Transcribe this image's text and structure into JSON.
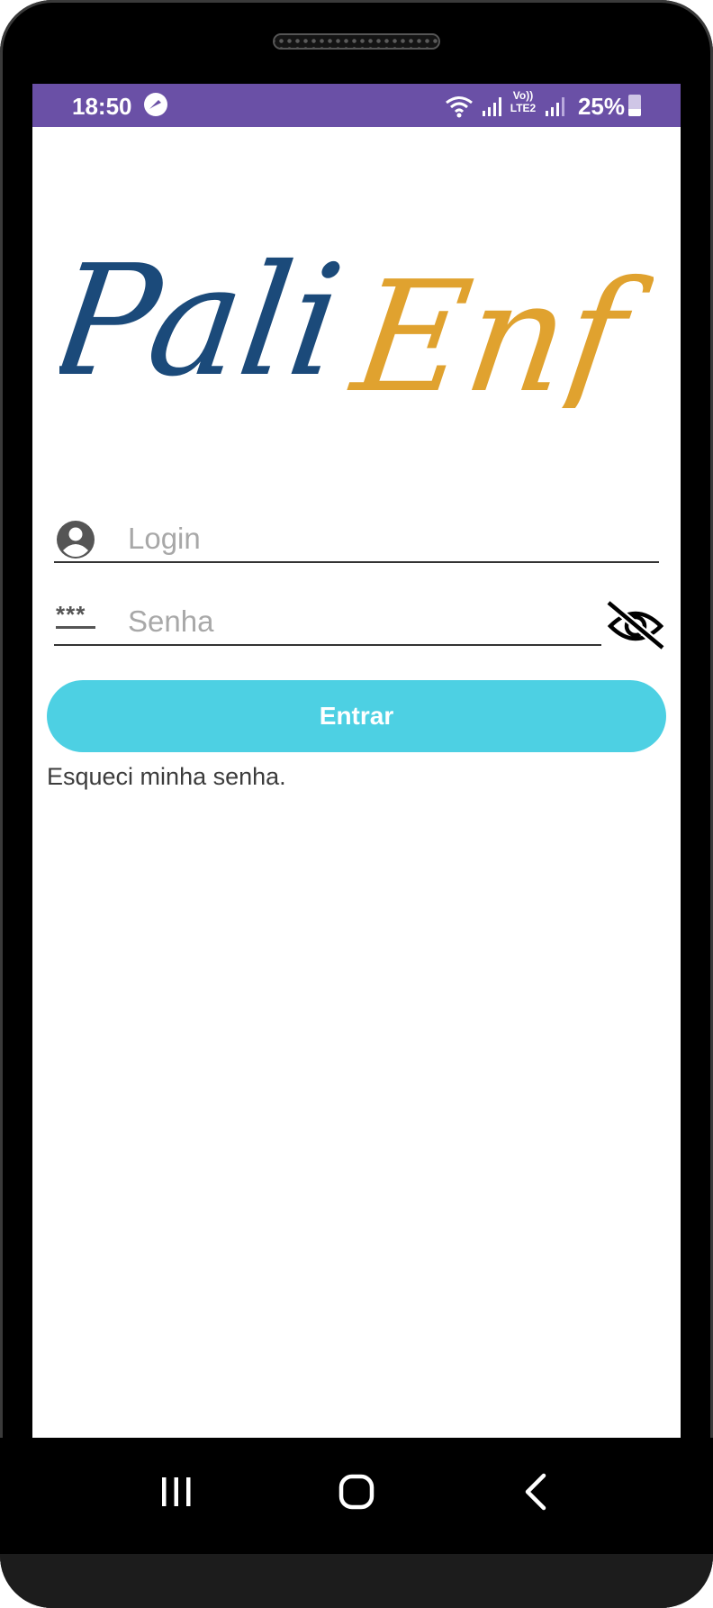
{
  "status_bar": {
    "time": "18:50",
    "battery_percent": "25%",
    "bg_color": "#6a50a6",
    "icons": [
      "messenger-icon",
      "wifi-icon",
      "signal-icon",
      "volte-icon",
      "signal-icon",
      "battery-icon"
    ],
    "volte_label": "Vo))",
    "lte_label": "LTE2"
  },
  "logo": {
    "word1": "Pali",
    "word2": "Enf",
    "color1": "#1b4a7a",
    "color2": "#e0a22f"
  },
  "login_form": {
    "login_placeholder": "Login",
    "password_placeholder": "Senha",
    "password_icon_text": "***",
    "submit_label": "Entrar",
    "submit_color": "#4dd0e3",
    "forgot_password_link": "Esqueci minha senha."
  },
  "nav_bar": {
    "icons": [
      "recent-apps-icon",
      "home-icon",
      "back-icon"
    ]
  }
}
